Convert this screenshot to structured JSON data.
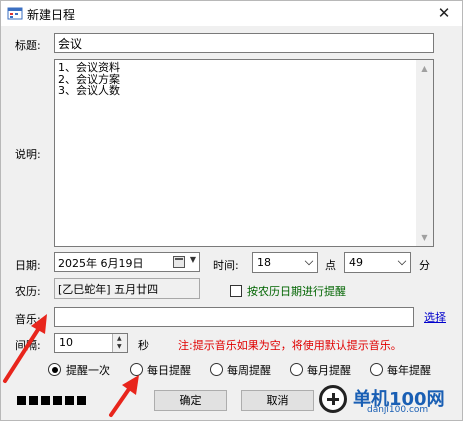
{
  "window": {
    "title": "新建日程",
    "close_glyph": "✕"
  },
  "form": {
    "title_label": "标题:",
    "title_value": "会议",
    "desc_label": "说明:",
    "desc_lines": [
      "1、会议资料",
      "2、会议方案",
      "3、会议人数"
    ],
    "date_label": "日期:",
    "date_value": "2025年 6月19日",
    "time_label": "时间:",
    "hour_value": "18",
    "hour_unit": "点",
    "minute_value": "49",
    "minute_unit": "分",
    "lunar_label": "农历:",
    "lunar_value": "[乙巳蛇年] 五月廿四",
    "lunar_checkbox_label": "按农历日期进行提醒",
    "lunar_checked": false,
    "music_label": "音乐:",
    "music_value": "",
    "browse_label": "选择",
    "interval_label": "间隔:",
    "interval_value": "10",
    "interval_unit": "秒",
    "note": "注:提示音乐如果为空，将使用默认提示音乐。"
  },
  "repeat_options": [
    {
      "label": "提醒一次",
      "selected": true
    },
    {
      "label": "每日提醒",
      "selected": false
    },
    {
      "label": "每周提醒",
      "selected": false
    },
    {
      "label": "每月提醒",
      "selected": false
    },
    {
      "label": "每年提醒",
      "selected": false
    }
  ],
  "buttons": {
    "ok": "确定",
    "cancel": "取消"
  },
  "watermark": {
    "brand": "单机100网",
    "domain": "danji100.com"
  },
  "colors": {
    "annotation_arrow": "#e8251c",
    "note_text": "#e00000",
    "checkbox_label": "#006400",
    "link": "#0000cc",
    "watermark": "#1a5fb4"
  }
}
